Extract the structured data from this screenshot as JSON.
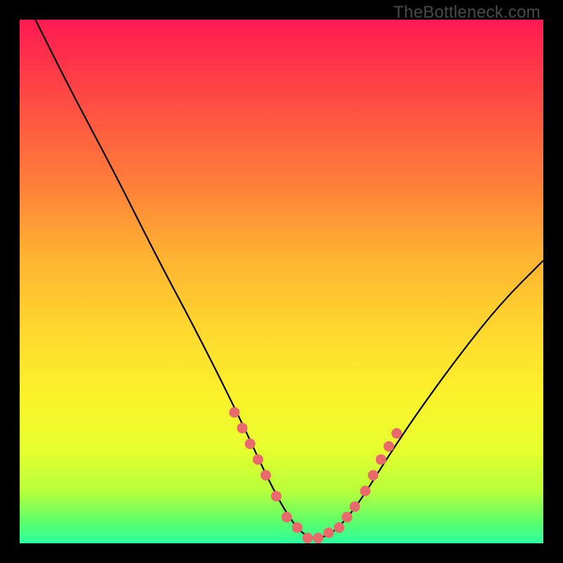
{
  "watermark": "TheBottleneck.com",
  "colors": {
    "gradient_top": "#ff1a52",
    "gradient_bottom": "#2cffa0",
    "curve": "#000000",
    "dots": "#e86a6a",
    "border": "#000000"
  },
  "chart_data": {
    "type": "line",
    "title": "",
    "xlabel": "",
    "ylabel": "",
    "xlim": [
      0,
      100
    ],
    "ylim": [
      0,
      100
    ],
    "series": [
      {
        "name": "bottleneck-curve",
        "x": [
          3,
          10,
          18,
          26,
          34,
          42,
          48,
          52,
          55,
          58,
          61,
          65,
          70,
          76,
          84,
          92,
          100
        ],
        "values": [
          100,
          86,
          71,
          55,
          40,
          24,
          11,
          4,
          1,
          1,
          3,
          8,
          16,
          25,
          36,
          46,
          54
        ]
      }
    ],
    "highlight_points": {
      "name": "sweet-spot-dots",
      "x": [
        41,
        42.5,
        44,
        45.5,
        47,
        49,
        51,
        53,
        55,
        57,
        59,
        61,
        62.5,
        64,
        66,
        67.5,
        69,
        70.5,
        72
      ],
      "values": [
        25,
        22,
        19,
        16,
        13,
        9,
        5,
        3,
        1,
        1,
        2,
        3,
        5,
        7,
        10,
        13,
        16,
        18.5,
        21
      ]
    }
  }
}
